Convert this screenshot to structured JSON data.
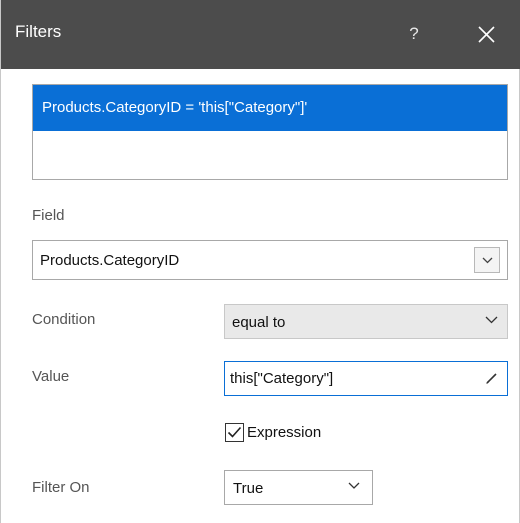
{
  "window": {
    "title": "Filters",
    "help_label": "?",
    "close_icon": "close-icon",
    "titlebar_color": "#4c4c4c"
  },
  "filter_list": {
    "items": [
      {
        "text": "Products.CategoryID = 'this[\"Category\"]'",
        "selected": true
      }
    ],
    "selection_color": "#0a6fd6"
  },
  "field": {
    "label": "Field",
    "value": "Products.CategoryID",
    "icon": "chevron-down-icon"
  },
  "condition": {
    "label": "Condition",
    "value": "equal to",
    "icon": "chevron-down-icon"
  },
  "value": {
    "label": "Value",
    "value": "this[\"Category\"]",
    "icon": "pencil-icon",
    "focus_color": "#0a6fd6"
  },
  "expression": {
    "label": "Expression",
    "checked": true,
    "icon": "checkmark-icon"
  },
  "filter_on": {
    "label": "Filter On",
    "value": "True",
    "icon": "chevron-down-icon"
  }
}
